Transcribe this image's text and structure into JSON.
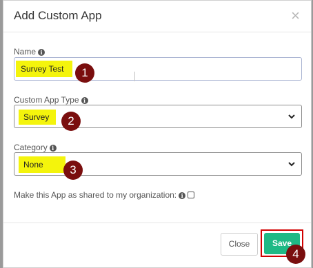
{
  "dialog": {
    "title": "Add Custom App",
    "close_glyph": "×"
  },
  "fields": {
    "name": {
      "label": "Name",
      "value": "Survey Test",
      "info_glyph": "i"
    },
    "type": {
      "label": "Custom App Type",
      "value": "Survey",
      "info_glyph": "i"
    },
    "category": {
      "label": "Category",
      "value": "None",
      "info_glyph": "i"
    }
  },
  "shared": {
    "label": "Make this App as shared to my organization:",
    "checked": false,
    "info_glyph": "i"
  },
  "footer": {
    "close_label": "Close",
    "save_label": "Save"
  },
  "annotations": {
    "step1": "1",
    "step2": "2",
    "step3": "3",
    "step4": "4"
  },
  "colors": {
    "highlight": "#f4f40c",
    "badge": "#7a0e0e",
    "save": "#1fb985",
    "save_outline": "#d10000"
  },
  "icons": {
    "close": "close-icon",
    "info": "info-icon",
    "select_arrow": "chevron-down-icon"
  }
}
